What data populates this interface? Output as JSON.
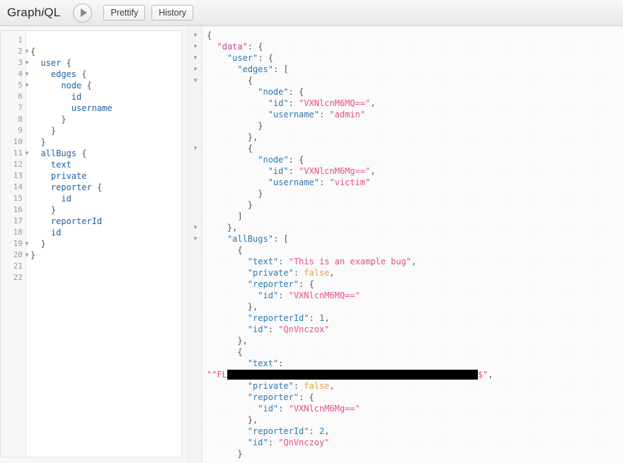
{
  "app": {
    "title_part1": "Graph",
    "title_italic": "i",
    "title_part2": "QL"
  },
  "toolbar": {
    "execute_label": "▶",
    "execute_name": "play-icon",
    "prettify_label": "Prettify",
    "history_label": "History"
  },
  "query_editor": {
    "line_numbers": [
      "1",
      "2",
      "3",
      "4",
      "5",
      "6",
      "7",
      "8",
      "9",
      "10",
      "11",
      "12",
      "13",
      "14",
      "15",
      "16",
      "17",
      "18",
      "19",
      "20",
      "21",
      "22"
    ],
    "fold_lines": [
      2,
      3,
      4,
      5,
      11,
      19,
      20
    ],
    "lines": [
      "",
      "{",
      "  user {",
      "    edges {",
      "      node {",
      "        id",
      "        username",
      "      }",
      "    }",
      "  }",
      "  allBugs {",
      "    text",
      "    private",
      "    reporter {",
      "      id",
      "    }",
      "    reporterId",
      "    id",
      "  }",
      "}",
      "",
      ""
    ]
  },
  "result_viewer": {
    "fold_rows": [
      0,
      1,
      2,
      3,
      4,
      10,
      17,
      18
    ],
    "lines": [
      [
        {
          "t": "punct",
          "v": "{"
        }
      ],
      [
        {
          "t": "punct",
          "v": "  "
        },
        {
          "t": "key-d",
          "v": "\"data\""
        },
        {
          "t": "punct",
          "v": ": {"
        }
      ],
      [
        {
          "t": "punct",
          "v": "    "
        },
        {
          "t": "key",
          "v": "\"user\""
        },
        {
          "t": "punct",
          "v": ": {"
        }
      ],
      [
        {
          "t": "punct",
          "v": "      "
        },
        {
          "t": "key",
          "v": "\"edges\""
        },
        {
          "t": "punct",
          "v": ": ["
        }
      ],
      [
        {
          "t": "punct",
          "v": "        {"
        }
      ],
      [
        {
          "t": "punct",
          "v": "          "
        },
        {
          "t": "key",
          "v": "\"node\""
        },
        {
          "t": "punct",
          "v": ": {"
        }
      ],
      [
        {
          "t": "punct",
          "v": "            "
        },
        {
          "t": "key",
          "v": "\"id\""
        },
        {
          "t": "punct",
          "v": ": "
        },
        {
          "t": "str",
          "v": "\"VXNlcnM6MQ==\""
        },
        {
          "t": "punct",
          "v": ","
        }
      ],
      [
        {
          "t": "punct",
          "v": "            "
        },
        {
          "t": "key",
          "v": "\"username\""
        },
        {
          "t": "punct",
          "v": ": "
        },
        {
          "t": "str",
          "v": "\"admin\""
        }
      ],
      [
        {
          "t": "punct",
          "v": "          }"
        }
      ],
      [
        {
          "t": "punct",
          "v": "        },"
        }
      ],
      [
        {
          "t": "punct",
          "v": "        {"
        }
      ],
      [
        {
          "t": "punct",
          "v": "          "
        },
        {
          "t": "key",
          "v": "\"node\""
        },
        {
          "t": "punct",
          "v": ": {"
        }
      ],
      [
        {
          "t": "punct",
          "v": "            "
        },
        {
          "t": "key",
          "v": "\"id\""
        },
        {
          "t": "punct",
          "v": ": "
        },
        {
          "t": "str",
          "v": "\"VXNlcnM6Mg==\""
        },
        {
          "t": "punct",
          "v": ","
        }
      ],
      [
        {
          "t": "punct",
          "v": "            "
        },
        {
          "t": "key",
          "v": "\"username\""
        },
        {
          "t": "punct",
          "v": ": "
        },
        {
          "t": "str",
          "v": "\"victim\""
        }
      ],
      [
        {
          "t": "punct",
          "v": "          }"
        }
      ],
      [
        {
          "t": "punct",
          "v": "        }"
        }
      ],
      [
        {
          "t": "punct",
          "v": "      ]"
        }
      ],
      [
        {
          "t": "punct",
          "v": "    },"
        }
      ],
      [
        {
          "t": "punct",
          "v": "    "
        },
        {
          "t": "key",
          "v": "\"allBugs\""
        },
        {
          "t": "punct",
          "v": ": ["
        }
      ],
      [
        {
          "t": "punct",
          "v": "      {"
        }
      ],
      [
        {
          "t": "punct",
          "v": "        "
        },
        {
          "t": "key",
          "v": "\"text\""
        },
        {
          "t": "punct",
          "v": ": "
        },
        {
          "t": "str",
          "v": "\"This is an example bug\""
        },
        {
          "t": "punct",
          "v": ","
        }
      ],
      [
        {
          "t": "punct",
          "v": "        "
        },
        {
          "t": "key",
          "v": "\"private\""
        },
        {
          "t": "punct",
          "v": ": "
        },
        {
          "t": "bool",
          "v": "false"
        },
        {
          "t": "punct",
          "v": ","
        }
      ],
      [
        {
          "t": "punct",
          "v": "        "
        },
        {
          "t": "key",
          "v": "\"reporter\""
        },
        {
          "t": "punct",
          "v": ": {"
        }
      ],
      [
        {
          "t": "punct",
          "v": "          "
        },
        {
          "t": "key",
          "v": "\"id\""
        },
        {
          "t": "punct",
          "v": ": "
        },
        {
          "t": "str",
          "v": "\"VXNlcnM6MQ==\""
        }
      ],
      [
        {
          "t": "punct",
          "v": "        },"
        }
      ],
      [
        {
          "t": "punct",
          "v": "        "
        },
        {
          "t": "key",
          "v": "\"reporterId\""
        },
        {
          "t": "punct",
          "v": ": "
        },
        {
          "t": "num",
          "v": "1"
        },
        {
          "t": "punct",
          "v": ","
        }
      ],
      [
        {
          "t": "punct",
          "v": "        "
        },
        {
          "t": "key",
          "v": "\"id\""
        },
        {
          "t": "punct",
          "v": ": "
        },
        {
          "t": "str",
          "v": "\"QnVnczox\""
        }
      ],
      [
        {
          "t": "punct",
          "v": "      },"
        }
      ],
      [
        {
          "t": "punct",
          "v": "      {"
        }
      ],
      [
        {
          "t": "punct",
          "v": "        "
        },
        {
          "t": "key",
          "v": "\"text\""
        },
        {
          "t": "punct",
          "v": ":"
        }
      ],
      [
        {
          "t": "str",
          "v": "\"^FL"
        },
        {
          "t": "redacted",
          "v": "                                                 "
        },
        {
          "t": "str",
          "v": "$\""
        },
        {
          "t": "punct",
          "v": ","
        }
      ],
      [
        {
          "t": "punct",
          "v": "        "
        },
        {
          "t": "key",
          "v": "\"private\""
        },
        {
          "t": "punct",
          "v": ": "
        },
        {
          "t": "bool",
          "v": "false"
        },
        {
          "t": "punct",
          "v": ","
        }
      ],
      [
        {
          "t": "punct",
          "v": "        "
        },
        {
          "t": "key",
          "v": "\"reporter\""
        },
        {
          "t": "punct",
          "v": ": {"
        }
      ],
      [
        {
          "t": "punct",
          "v": "          "
        },
        {
          "t": "key",
          "v": "\"id\""
        },
        {
          "t": "punct",
          "v": ": "
        },
        {
          "t": "str",
          "v": "\"VXNlcnM6Mg==\""
        }
      ],
      [
        {
          "t": "punct",
          "v": "        },"
        }
      ],
      [
        {
          "t": "punct",
          "v": "        "
        },
        {
          "t": "key",
          "v": "\"reporterId\""
        },
        {
          "t": "punct",
          "v": ": "
        },
        {
          "t": "num",
          "v": "2"
        },
        {
          "t": "punct",
          "v": ","
        }
      ],
      [
        {
          "t": "punct",
          "v": "        "
        },
        {
          "t": "key",
          "v": "\"id\""
        },
        {
          "t": "punct",
          "v": ": "
        },
        {
          "t": "str",
          "v": "\"QnVnczoy\""
        }
      ],
      [
        {
          "t": "punct",
          "v": "      }"
        }
      ]
    ]
  },
  "colors": {
    "key": "#2a7ab0",
    "key_data": "#d64292",
    "string": "#e94a8c",
    "number": "#2a7ab0",
    "boolean": "#e8a33d",
    "query_field": "#1f61a0",
    "redaction": "#000000"
  }
}
